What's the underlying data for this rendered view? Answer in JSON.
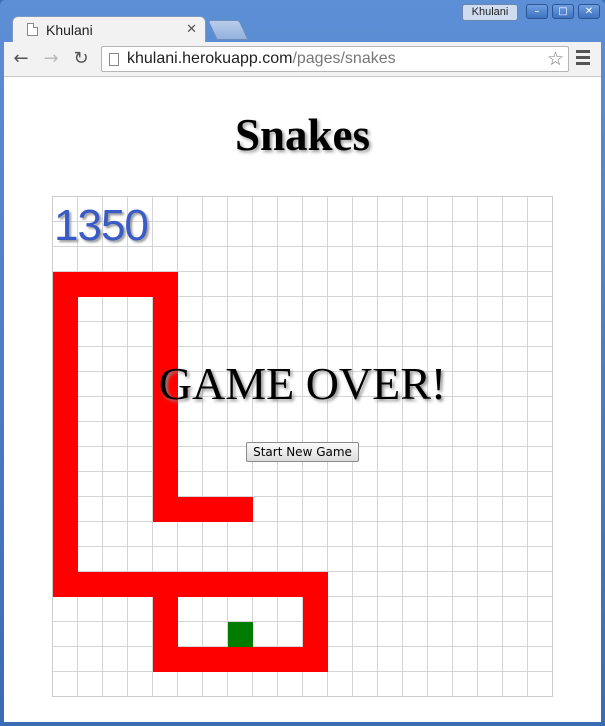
{
  "browser": {
    "profile_name": "Khulani",
    "tab": {
      "title": "Khulani"
    },
    "url": {
      "host": "khulani.herokuapp.com",
      "path": "/pages/snakes"
    }
  },
  "page": {
    "title": "Snakes"
  },
  "game": {
    "score": "1350",
    "message": "GAME OVER!",
    "new_game_label": "Start New Game",
    "grid": {
      "columns": 20,
      "rows": 20
    },
    "colors": {
      "snake": "#ff0000",
      "food": "#007c00",
      "score": "#3a5bc5"
    },
    "snake_cells": [
      [
        0,
        3
      ],
      [
        1,
        3
      ],
      [
        2,
        3
      ],
      [
        3,
        3
      ],
      [
        4,
        3
      ],
      [
        0,
        4
      ],
      [
        4,
        4
      ],
      [
        0,
        5
      ],
      [
        4,
        5
      ],
      [
        0,
        6
      ],
      [
        4,
        6
      ],
      [
        0,
        7
      ],
      [
        4,
        7
      ],
      [
        0,
        8
      ],
      [
        4,
        8
      ],
      [
        0,
        9
      ],
      [
        4,
        9
      ],
      [
        0,
        10
      ],
      [
        4,
        10
      ],
      [
        0,
        11
      ],
      [
        4,
        11
      ],
      [
        0,
        12
      ],
      [
        4,
        12
      ],
      [
        5,
        12
      ],
      [
        6,
        12
      ],
      [
        7,
        12
      ],
      [
        0,
        13
      ],
      [
        0,
        14
      ],
      [
        0,
        15
      ],
      [
        1,
        15
      ],
      [
        2,
        15
      ],
      [
        3,
        15
      ],
      [
        4,
        15
      ],
      [
        5,
        15
      ],
      [
        6,
        15
      ],
      [
        7,
        15
      ],
      [
        8,
        15
      ],
      [
        9,
        15
      ],
      [
        10,
        15
      ],
      [
        4,
        16
      ],
      [
        10,
        16
      ],
      [
        4,
        17
      ],
      [
        10,
        17
      ],
      [
        4,
        18
      ],
      [
        5,
        18
      ],
      [
        6,
        18
      ],
      [
        7,
        18
      ],
      [
        8,
        18
      ],
      [
        9,
        18
      ],
      [
        10,
        18
      ]
    ],
    "food_cell": [
      7,
      17
    ]
  }
}
